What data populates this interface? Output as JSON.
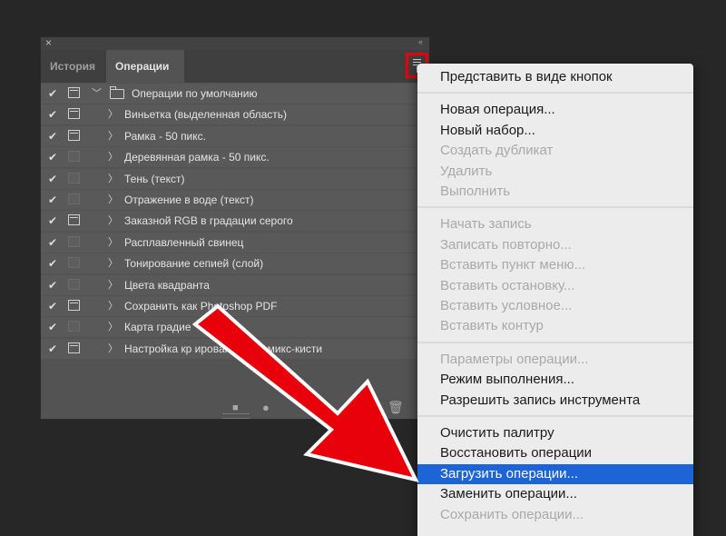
{
  "panel": {
    "close_glyph": "×",
    "collapse_glyph": "‹‹",
    "tabs": [
      {
        "label": "История",
        "active": false
      },
      {
        "label": "Операции",
        "active": true
      }
    ],
    "menu_icon": "panel-menu-icon",
    "action_set": {
      "label": "Операции по умолчанию",
      "checked": true,
      "dialog": true
    },
    "actions": [
      {
        "label": "Виньетка (выделенная область)",
        "checked": true,
        "dialog": true
      },
      {
        "label": "Рамка - 50 пикс.",
        "checked": true,
        "dialog": true
      },
      {
        "label": "Деревянная рамка - 50 пикс.",
        "checked": true,
        "dialog": false
      },
      {
        "label": "Тень (текст)",
        "checked": true,
        "dialog": false
      },
      {
        "label": "Отражение в воде (текст)",
        "checked": true,
        "dialog": false
      },
      {
        "label": "Заказной RGB в градации серого",
        "checked": true,
        "dialog": true
      },
      {
        "label": "Расплавленный свинец",
        "checked": true,
        "dialog": false
      },
      {
        "label": "Тонирование сепией (слой)",
        "checked": true,
        "dialog": false
      },
      {
        "label": "Цвета квадранта",
        "checked": true,
        "dialog": false
      },
      {
        "label": "Сохранить как Photoshop PDF",
        "checked": true,
        "dialog": true
      },
      {
        "label": "Карта градие",
        "checked": true,
        "dialog": false
      },
      {
        "label": "Настройка кр                ирования для микс-кисти",
        "checked": true,
        "dialog": true
      }
    ],
    "bottom_icons": [
      "stop-icon",
      "record-icon",
      "play-icon",
      "new-set-icon",
      "new-action-icon",
      "trash-icon"
    ]
  },
  "menu": {
    "groups": [
      [
        {
          "label": "Представить в виде кнопок",
          "enabled": true
        }
      ],
      [
        {
          "label": "Новая операция...",
          "enabled": true
        },
        {
          "label": "Новый набор...",
          "enabled": true
        },
        {
          "label": "Создать дубликат",
          "enabled": false
        },
        {
          "label": "Удалить",
          "enabled": false
        },
        {
          "label": "Выполнить",
          "enabled": false
        }
      ],
      [
        {
          "label": "Начать запись",
          "enabled": false
        },
        {
          "label": "Записать повторно...",
          "enabled": false
        },
        {
          "label": "Вставить пункт меню...",
          "enabled": false
        },
        {
          "label": "Вставить остановку...",
          "enabled": false
        },
        {
          "label": "Вставить условное...",
          "enabled": false
        },
        {
          "label": "Вставить контур",
          "enabled": false
        }
      ],
      [
        {
          "label": "Параметры операции...",
          "enabled": false
        },
        {
          "label": "Режим выполнения...",
          "enabled": true
        },
        {
          "label": "Разрешить запись инструмента",
          "enabled": true
        }
      ],
      [
        {
          "label": "Очистить палитру",
          "enabled": true
        },
        {
          "label": "Восстановить операции",
          "enabled": true
        },
        {
          "label": "Загрузить операции...",
          "enabled": true,
          "highlighted": true
        },
        {
          "label": "Заменить операции...",
          "enabled": true
        },
        {
          "label": "Сохранить операции...",
          "enabled": false
        }
      ]
    ]
  },
  "colors": {
    "highlight": "#1d64d7",
    "annotation_red": "#e8000a",
    "panel_bg": "#535353",
    "menu_bg": "#ececec"
  }
}
